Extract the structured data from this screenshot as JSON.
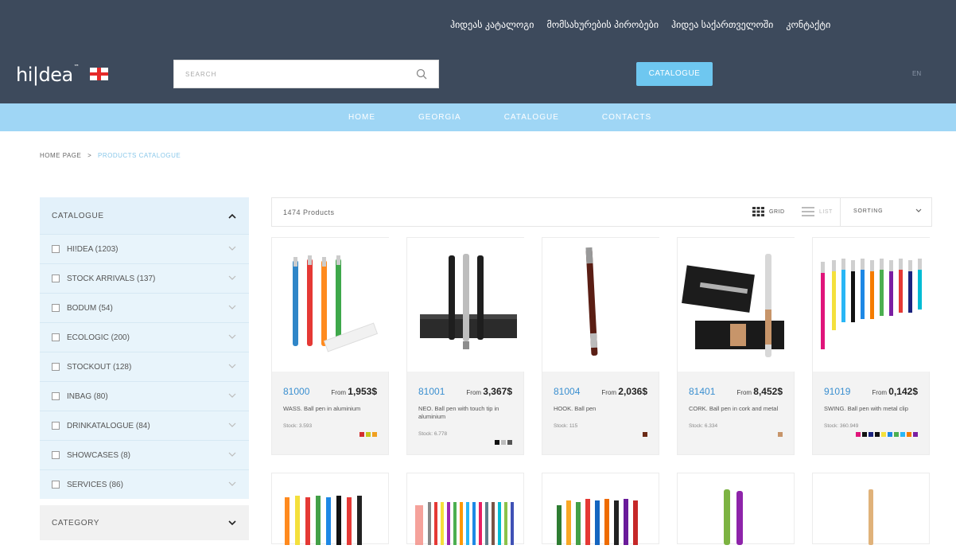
{
  "header": {
    "top_links": [
      "ჰიდეას კატალოგი",
      "მომსახურების პირობები",
      "ჰიდეა საქართველოში",
      "კონტაქტი"
    ],
    "logo_text": "hi|dea",
    "logo_tm": "™",
    "search_placeholder": "SEARCH",
    "catalogue_button": "CATALOGUE",
    "language": "EN"
  },
  "nav": {
    "items": [
      "HOME",
      "GEORGIA",
      "CATALOGUE",
      "CONTACTS"
    ]
  },
  "breadcrumb": {
    "home": "HOME PAGE",
    "separator": ">",
    "current": "PRODUCTS CATALOGUE"
  },
  "sidebar": {
    "catalogue_title": "CATALOGUE",
    "items": [
      {
        "label": "HI!DEA (1203)"
      },
      {
        "label": "STOCK ARRIVALS (137)"
      },
      {
        "label": "BODUM (54)"
      },
      {
        "label": "ECOLOGIC (200)"
      },
      {
        "label": "STOCKOUT (128)"
      },
      {
        "label": "INBAG (80)"
      },
      {
        "label": "DRINKATALOGUE (84)"
      },
      {
        "label": "SHOWCASES (8)"
      },
      {
        "label": "SERVICES (86)"
      }
    ],
    "category_title": "CATEGORY"
  },
  "toolbar": {
    "count": "1474 Products",
    "grid_label": "GRID",
    "list_label": "LIST",
    "sorting_label": "SORTING"
  },
  "products": [
    {
      "code": "81000",
      "from": "From",
      "price": "1,953$",
      "name": "WASS. Ball pen in aluminium",
      "stock": "Stock: 3.593",
      "colors": [
        "#d32f2f",
        "#c6c81c",
        "#f0a020"
      ]
    },
    {
      "code": "81001",
      "from": "From",
      "price": "3,367$",
      "name": "NEO. Ball pen with touch tip in aluminium",
      "stock": "Stock: 6.778",
      "colors": [
        "#111111",
        "#bdbdbd",
        "#555555"
      ]
    },
    {
      "code": "81004",
      "from": "From",
      "price": "2,036$",
      "name": "HOOK. Ball pen",
      "stock": "Stock: 115",
      "colors": [
        "#6b2a16"
      ]
    },
    {
      "code": "81401",
      "from": "From",
      "price": "8,452$",
      "name": "CORK. Ball pen in cork and metal",
      "stock": "Stock: 6.334",
      "colors": [
        "#c7956a"
      ]
    },
    {
      "code": "91019",
      "from": "From",
      "price": "0,142$",
      "name": "SWING. Ball pen with metal clip",
      "stock": "Stock: 360.949",
      "colors": [
        "#e0157a",
        "#111111",
        "#1a237e",
        "#111111",
        "#f4e03c",
        "#1e88e5",
        "#4caf50",
        "#29b6f6",
        "#f57c00",
        "#7b1fa2"
      ]
    }
  ],
  "accent_colors": {
    "header": "#3d4a5c",
    "nav": "#9fd6f5",
    "button": "#6ec7f0",
    "link": "#3a8fd0"
  }
}
